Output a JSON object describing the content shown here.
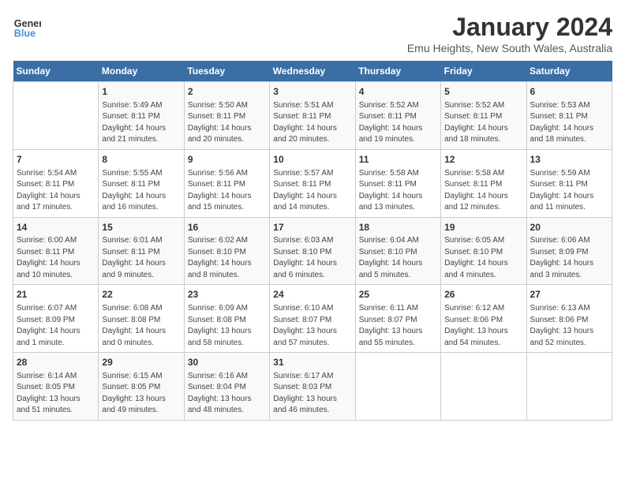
{
  "header": {
    "logo_line1": "General",
    "logo_line2": "Blue",
    "month": "January 2024",
    "location": "Emu Heights, New South Wales, Australia"
  },
  "days_of_week": [
    "Sunday",
    "Monday",
    "Tuesday",
    "Wednesday",
    "Thursday",
    "Friday",
    "Saturday"
  ],
  "weeks": [
    [
      {
        "day": "",
        "info": ""
      },
      {
        "day": "1",
        "info": "Sunrise: 5:49 AM\nSunset: 8:11 PM\nDaylight: 14 hours\nand 21 minutes."
      },
      {
        "day": "2",
        "info": "Sunrise: 5:50 AM\nSunset: 8:11 PM\nDaylight: 14 hours\nand 20 minutes."
      },
      {
        "day": "3",
        "info": "Sunrise: 5:51 AM\nSunset: 8:11 PM\nDaylight: 14 hours\nand 20 minutes."
      },
      {
        "day": "4",
        "info": "Sunrise: 5:52 AM\nSunset: 8:11 PM\nDaylight: 14 hours\nand 19 minutes."
      },
      {
        "day": "5",
        "info": "Sunrise: 5:52 AM\nSunset: 8:11 PM\nDaylight: 14 hours\nand 18 minutes."
      },
      {
        "day": "6",
        "info": "Sunrise: 5:53 AM\nSunset: 8:11 PM\nDaylight: 14 hours\nand 18 minutes."
      }
    ],
    [
      {
        "day": "7",
        "info": "Sunrise: 5:54 AM\nSunset: 8:11 PM\nDaylight: 14 hours\nand 17 minutes."
      },
      {
        "day": "8",
        "info": "Sunrise: 5:55 AM\nSunset: 8:11 PM\nDaylight: 14 hours\nand 16 minutes."
      },
      {
        "day": "9",
        "info": "Sunrise: 5:56 AM\nSunset: 8:11 PM\nDaylight: 14 hours\nand 15 minutes."
      },
      {
        "day": "10",
        "info": "Sunrise: 5:57 AM\nSunset: 8:11 PM\nDaylight: 14 hours\nand 14 minutes."
      },
      {
        "day": "11",
        "info": "Sunrise: 5:58 AM\nSunset: 8:11 PM\nDaylight: 14 hours\nand 13 minutes."
      },
      {
        "day": "12",
        "info": "Sunrise: 5:58 AM\nSunset: 8:11 PM\nDaylight: 14 hours\nand 12 minutes."
      },
      {
        "day": "13",
        "info": "Sunrise: 5:59 AM\nSunset: 8:11 PM\nDaylight: 14 hours\nand 11 minutes."
      }
    ],
    [
      {
        "day": "14",
        "info": "Sunrise: 6:00 AM\nSunset: 8:11 PM\nDaylight: 14 hours\nand 10 minutes."
      },
      {
        "day": "15",
        "info": "Sunrise: 6:01 AM\nSunset: 8:11 PM\nDaylight: 14 hours\nand 9 minutes."
      },
      {
        "day": "16",
        "info": "Sunrise: 6:02 AM\nSunset: 8:10 PM\nDaylight: 14 hours\nand 8 minutes."
      },
      {
        "day": "17",
        "info": "Sunrise: 6:03 AM\nSunset: 8:10 PM\nDaylight: 14 hours\nand 6 minutes."
      },
      {
        "day": "18",
        "info": "Sunrise: 6:04 AM\nSunset: 8:10 PM\nDaylight: 14 hours\nand 5 minutes."
      },
      {
        "day": "19",
        "info": "Sunrise: 6:05 AM\nSunset: 8:10 PM\nDaylight: 14 hours\nand 4 minutes."
      },
      {
        "day": "20",
        "info": "Sunrise: 6:06 AM\nSunset: 8:09 PM\nDaylight: 14 hours\nand 3 minutes."
      }
    ],
    [
      {
        "day": "21",
        "info": "Sunrise: 6:07 AM\nSunset: 8:09 PM\nDaylight: 14 hours\nand 1 minute."
      },
      {
        "day": "22",
        "info": "Sunrise: 6:08 AM\nSunset: 8:08 PM\nDaylight: 14 hours\nand 0 minutes."
      },
      {
        "day": "23",
        "info": "Sunrise: 6:09 AM\nSunset: 8:08 PM\nDaylight: 13 hours\nand 58 minutes."
      },
      {
        "day": "24",
        "info": "Sunrise: 6:10 AM\nSunset: 8:07 PM\nDaylight: 13 hours\nand 57 minutes."
      },
      {
        "day": "25",
        "info": "Sunrise: 6:11 AM\nSunset: 8:07 PM\nDaylight: 13 hours\nand 55 minutes."
      },
      {
        "day": "26",
        "info": "Sunrise: 6:12 AM\nSunset: 8:06 PM\nDaylight: 13 hours\nand 54 minutes."
      },
      {
        "day": "27",
        "info": "Sunrise: 6:13 AM\nSunset: 8:06 PM\nDaylight: 13 hours\nand 52 minutes."
      }
    ],
    [
      {
        "day": "28",
        "info": "Sunrise: 6:14 AM\nSunset: 8:05 PM\nDaylight: 13 hours\nand 51 minutes."
      },
      {
        "day": "29",
        "info": "Sunrise: 6:15 AM\nSunset: 8:05 PM\nDaylight: 13 hours\nand 49 minutes."
      },
      {
        "day": "30",
        "info": "Sunrise: 6:16 AM\nSunset: 8:04 PM\nDaylight: 13 hours\nand 48 minutes."
      },
      {
        "day": "31",
        "info": "Sunrise: 6:17 AM\nSunset: 8:03 PM\nDaylight: 13 hours\nand 46 minutes."
      },
      {
        "day": "",
        "info": ""
      },
      {
        "day": "",
        "info": ""
      },
      {
        "day": "",
        "info": ""
      }
    ]
  ]
}
